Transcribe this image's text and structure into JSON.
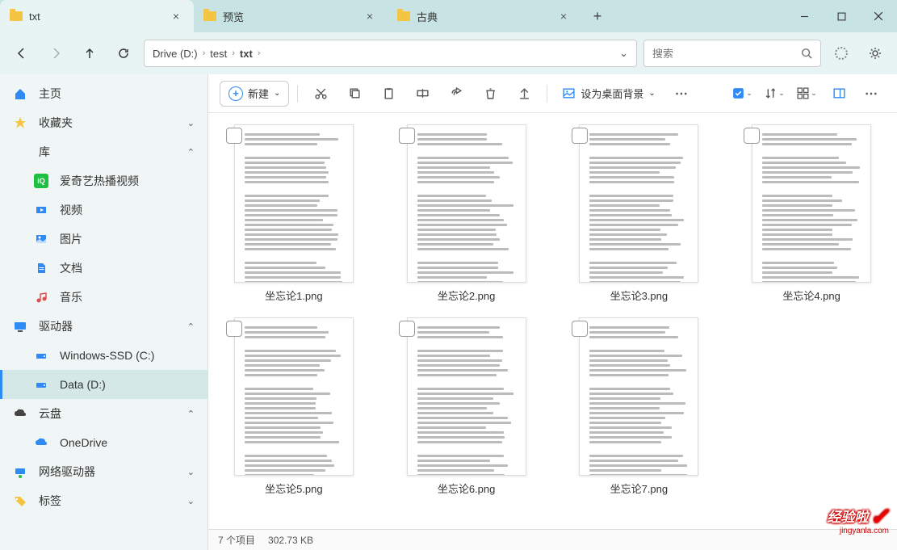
{
  "tabs": [
    {
      "label": "txt",
      "active": true
    },
    {
      "label": "预览",
      "active": false
    },
    {
      "label": "古典",
      "active": false
    }
  ],
  "breadcrumb": {
    "parts": [
      "Drive (D:)",
      "test",
      "txt"
    ]
  },
  "search": {
    "placeholder": "搜索"
  },
  "sidebar": {
    "home": "主页",
    "favorites": "收藏夹",
    "library": "库",
    "items": [
      "爱奇艺热播视频",
      "视频",
      "图片",
      "文档",
      "音乐"
    ],
    "drives": "驱动器",
    "driveItems": [
      "Windows-SSD (C:)",
      "Data (D:)"
    ],
    "cloud": "云盘",
    "cloudItems": [
      "OneDrive"
    ],
    "network": "网络驱动器",
    "tags": "标签"
  },
  "cmdbar": {
    "new": "新建",
    "wallpaper": "设为桌面背景"
  },
  "files": [
    {
      "name": "坐忘论1.png"
    },
    {
      "name": "坐忘论2.png"
    },
    {
      "name": "坐忘论3.png"
    },
    {
      "name": "坐忘论4.png"
    },
    {
      "name": "坐忘论5.png"
    },
    {
      "name": "坐忘论6.png"
    },
    {
      "name": "坐忘论7.png"
    }
  ],
  "status": {
    "count": "7 个项目",
    "size": "302.73 KB"
  },
  "watermark": {
    "main": "经验啦",
    "sub": "jingyanla.com"
  }
}
